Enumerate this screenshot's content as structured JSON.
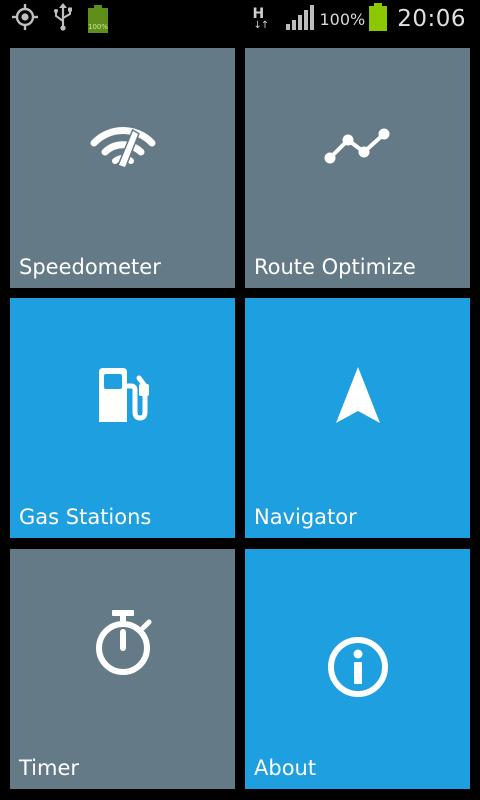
{
  "status_bar": {
    "icons": [
      "gps-icon",
      "usb-icon",
      "battery-charging-icon",
      "network-h-icon",
      "signal-icon",
      "battery-icon"
    ],
    "mini_battery_text": "100%",
    "network_type": "H",
    "network_arrows": "↓↑",
    "battery_percent": "100%",
    "time": "20:06"
  },
  "colors": {
    "gray_tile": "#647b87",
    "blue_tile": "#1e9fdf",
    "battery_green": "#8bc800",
    "mini_battery_green": "#5f8f1a"
  },
  "tiles": [
    {
      "label": "Speedometer",
      "icon": "speedometer-icon",
      "color": "#647b87"
    },
    {
      "label": "Route Optimize",
      "icon": "route-line-icon",
      "color": "#647b87"
    },
    {
      "label": "Gas Stations",
      "icon": "gas-pump-icon",
      "color": "#1e9fdf"
    },
    {
      "label": "Navigator",
      "icon": "navigation-arrow-icon",
      "color": "#1e9fdf"
    },
    {
      "label": "Timer",
      "icon": "stopwatch-icon",
      "color": "#647b87"
    },
    {
      "label": "About",
      "icon": "info-icon",
      "color": "#1e9fdf"
    }
  ]
}
